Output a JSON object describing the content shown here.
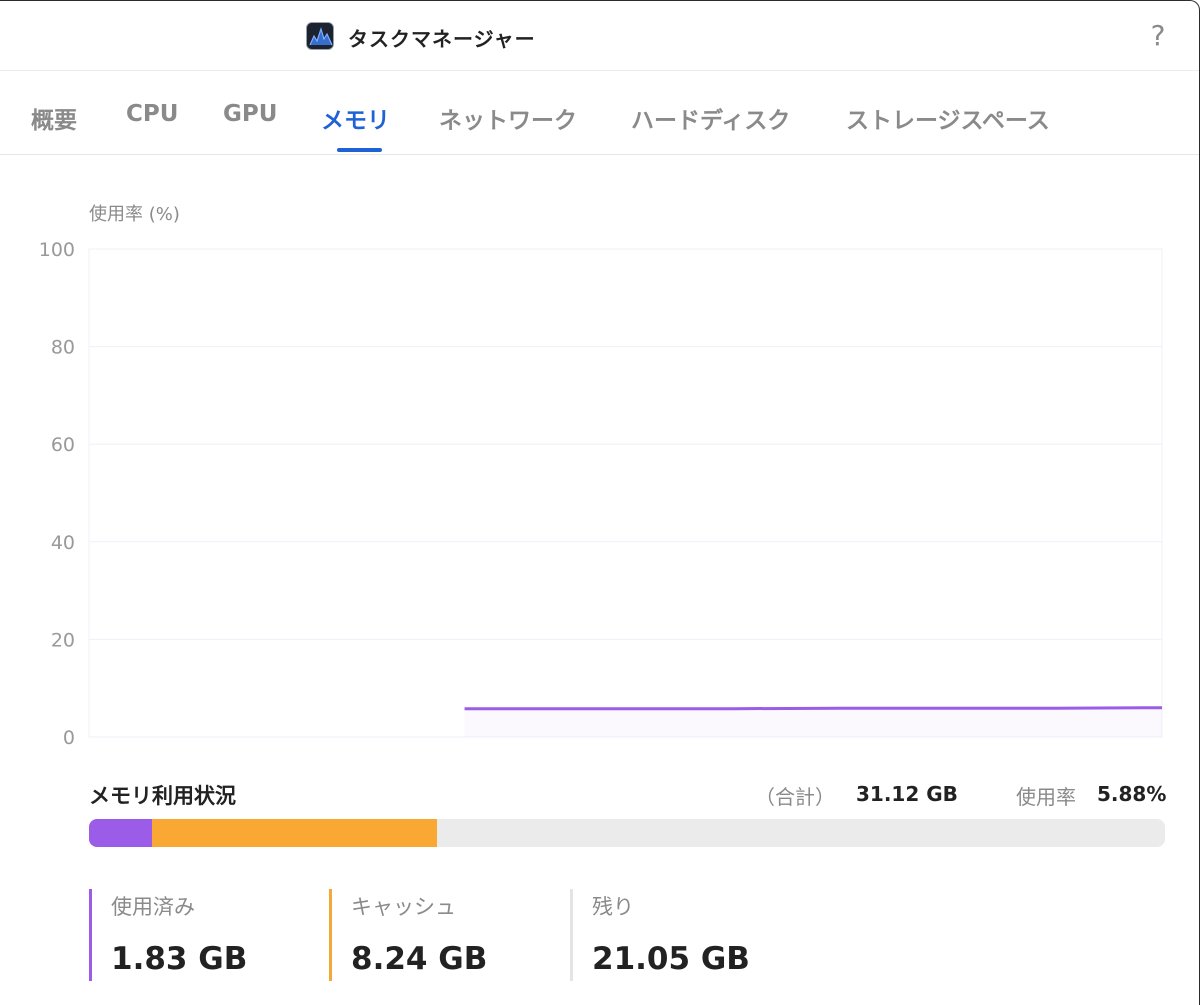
{
  "window": {
    "title": "タスクマネージャー",
    "app_icon": "activity-monitor-icon",
    "help_label": "?"
  },
  "tabs": [
    {
      "label": "概要",
      "active": false
    },
    {
      "label": "CPU",
      "active": false
    },
    {
      "label": "GPU",
      "active": false
    },
    {
      "label": "メモリ",
      "active": true
    },
    {
      "label": "ネットワーク",
      "active": false
    },
    {
      "label": "ハードディスク",
      "active": false
    },
    {
      "label": "ストレージスペース",
      "active": false
    }
  ],
  "chart_data": {
    "type": "line",
    "ylabel": "使用率 (%)",
    "ylim": [
      0,
      100
    ],
    "yticks": [
      "100",
      "80",
      "60",
      "40",
      "20",
      "0"
    ],
    "grid": true,
    "x": [
      35,
      40,
      50,
      60,
      70,
      80,
      90,
      100
    ],
    "xlim": [
      0,
      100
    ],
    "series": [
      {
        "color": "#9b5ce8",
        "values": [
          5.8,
          5.8,
          5.8,
          5.8,
          5.9,
          5.9,
          5.9,
          6.0
        ]
      }
    ]
  },
  "memory": {
    "title": "メモリ利用状況",
    "total_label": "（合計）",
    "total_value": "31.12 GB",
    "rate_label": "使用率",
    "rate_value": "5.88%",
    "segments": [
      {
        "key": "used",
        "fraction": 0.0588,
        "color": "#9b5ce8"
      },
      {
        "key": "cache",
        "fraction": 0.2648,
        "color": "#faa834"
      }
    ],
    "track_color": "#ebebeb"
  },
  "stats": [
    {
      "label": "使用済み",
      "value": "1.83 GB",
      "color": "#9b5ce8"
    },
    {
      "label": "キャッシュ",
      "value": "8.24 GB",
      "color": "#f2a93b"
    },
    {
      "label": "残り",
      "value": "21.05 GB",
      "color": "#e4e4e4"
    }
  ]
}
